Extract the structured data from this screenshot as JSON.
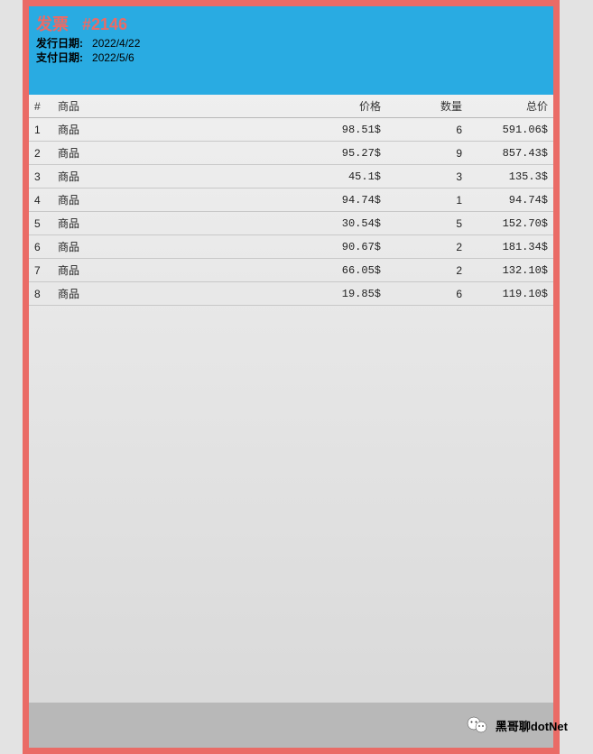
{
  "header": {
    "title_prefix": "发票",
    "title_number": "#2146",
    "issue_label": "发行日期:",
    "issue_date": "2022/4/22",
    "pay_label": "支付日期:",
    "pay_date": "2022/5/6"
  },
  "columns": {
    "num": "#",
    "product": "商品",
    "price": "价格",
    "qty": "数量",
    "total": "总价"
  },
  "rows": [
    {
      "n": "1",
      "product": "商品",
      "price": "98.51$",
      "qty": "6",
      "total": "591.06$"
    },
    {
      "n": "2",
      "product": "商品",
      "price": "95.27$",
      "qty": "9",
      "total": "857.43$"
    },
    {
      "n": "3",
      "product": "商品",
      "price": "45.1$",
      "qty": "3",
      "total": "135.3$"
    },
    {
      "n": "4",
      "product": "商品",
      "price": "94.74$",
      "qty": "1",
      "total": "94.74$"
    },
    {
      "n": "5",
      "product": "商品",
      "price": "30.54$",
      "qty": "5",
      "total": "152.70$"
    },
    {
      "n": "6",
      "product": "商品",
      "price": "90.67$",
      "qty": "2",
      "total": "181.34$"
    },
    {
      "n": "7",
      "product": "商品",
      "price": "66.05$",
      "qty": "2",
      "total": "132.10$"
    },
    {
      "n": "8",
      "product": "商品",
      "price": "19.85$",
      "qty": "6",
      "total": "119.10$"
    }
  ],
  "attribution": {
    "text": "黑哥聊dotNet"
  }
}
